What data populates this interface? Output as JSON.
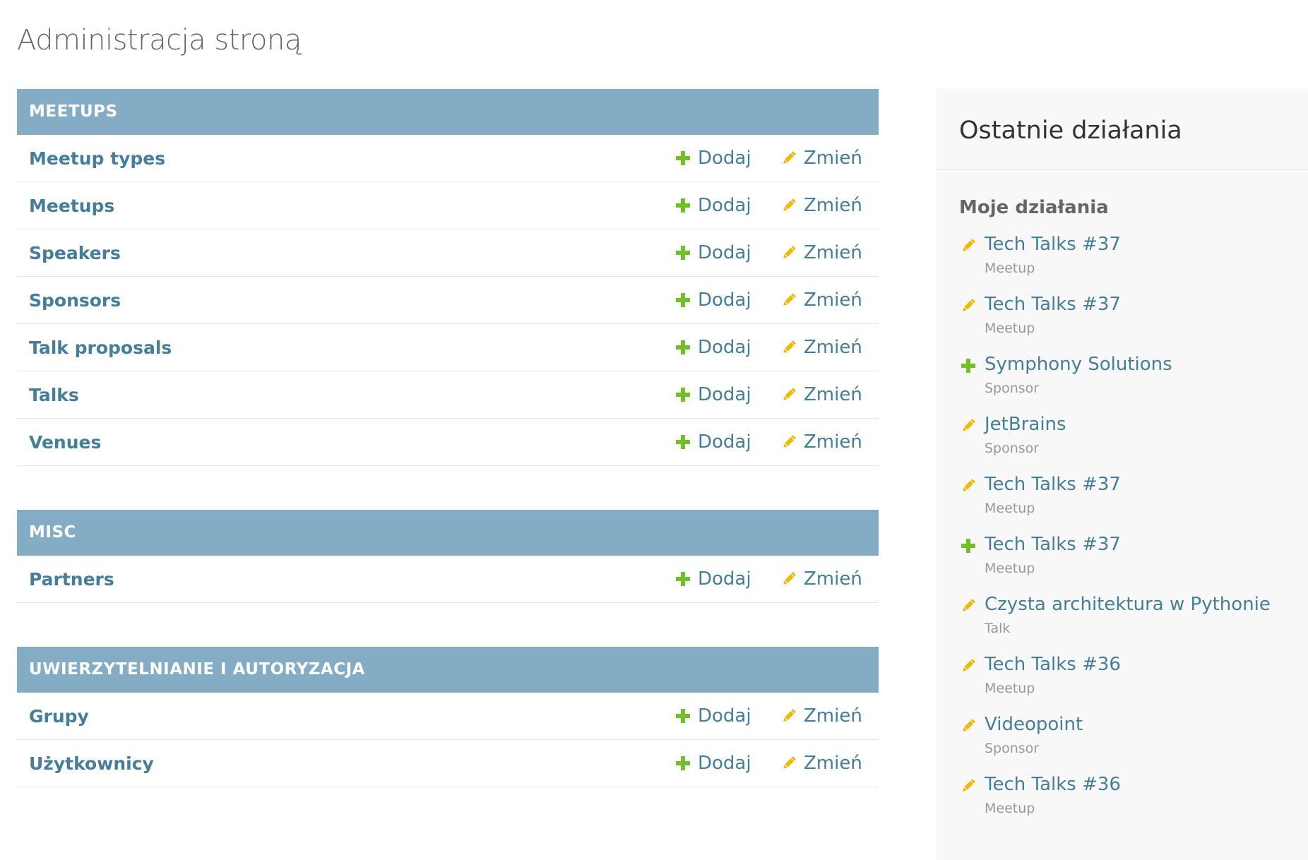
{
  "page_title": "Administracja stroną",
  "colors": {
    "caption_bg": "#85acc5",
    "link": "#447e9b",
    "add_icon": "#70bf2b",
    "change_icon": "#efb80b"
  },
  "modules": [
    {
      "caption": "MEETUPS",
      "models": [
        {
          "name": "Meetup types",
          "add": "Dodaj",
          "change": "Zmień"
        },
        {
          "name": "Meetups",
          "add": "Dodaj",
          "change": "Zmień"
        },
        {
          "name": "Speakers",
          "add": "Dodaj",
          "change": "Zmień"
        },
        {
          "name": "Sponsors",
          "add": "Dodaj",
          "change": "Zmień"
        },
        {
          "name": "Talk proposals",
          "add": "Dodaj",
          "change": "Zmień"
        },
        {
          "name": "Talks",
          "add": "Dodaj",
          "change": "Zmień"
        },
        {
          "name": "Venues",
          "add": "Dodaj",
          "change": "Zmień"
        }
      ]
    },
    {
      "caption": "MISC",
      "models": [
        {
          "name": "Partners",
          "add": "Dodaj",
          "change": "Zmień"
        }
      ]
    },
    {
      "caption": "UWIERZYTELNIANIE I AUTORYZACJA",
      "models": [
        {
          "name": "Grupy",
          "add": "Dodaj",
          "change": "Zmień"
        },
        {
          "name": "Użytkownicy",
          "add": "Dodaj",
          "change": "Zmień"
        }
      ]
    }
  ],
  "sidebar": {
    "title": "Ostatnie działania",
    "subtitle": "Moje działania",
    "actions": [
      {
        "icon": "pencil-icon",
        "label": "Tech Talks #37",
        "type": "Meetup"
      },
      {
        "icon": "pencil-icon",
        "label": "Tech Talks #37",
        "type": "Meetup"
      },
      {
        "icon": "plus-icon",
        "label": "Symphony Solutions",
        "type": "Sponsor"
      },
      {
        "icon": "pencil-icon",
        "label": "JetBrains",
        "type": "Sponsor"
      },
      {
        "icon": "pencil-icon",
        "label": "Tech Talks #37",
        "type": "Meetup"
      },
      {
        "icon": "plus-icon",
        "label": "Tech Talks #37",
        "type": "Meetup"
      },
      {
        "icon": "pencil-icon",
        "label": "Czysta architektura w Pythonie",
        "type": "Talk"
      },
      {
        "icon": "pencil-icon",
        "label": "Tech Talks #36",
        "type": "Meetup"
      },
      {
        "icon": "pencil-icon",
        "label": "Videopoint",
        "type": "Sponsor"
      },
      {
        "icon": "pencil-icon",
        "label": "Tech Talks #36",
        "type": "Meetup"
      }
    ]
  }
}
